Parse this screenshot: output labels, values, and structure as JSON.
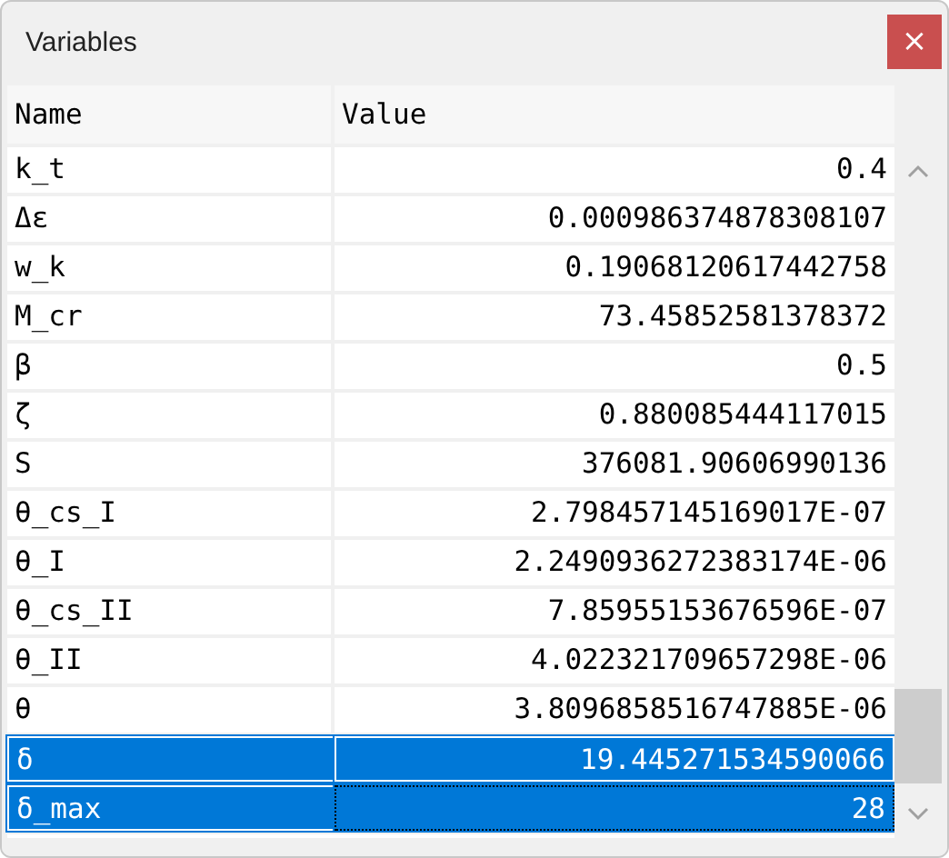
{
  "window": {
    "title": "Variables",
    "close": "×"
  },
  "table": {
    "columns": [
      "Name",
      "Value"
    ],
    "rows": [
      {
        "name": "k_t",
        "value": "0.4",
        "selected": false,
        "focused": false
      },
      {
        "name": "Δε",
        "value": "0.000986374878308107",
        "selected": false,
        "focused": false
      },
      {
        "name": "w_k",
        "value": "0.19068120617442758",
        "selected": false,
        "focused": false
      },
      {
        "name": "M_cr",
        "value": "73.45852581378372",
        "selected": false,
        "focused": false
      },
      {
        "name": "β",
        "value": "0.5",
        "selected": false,
        "focused": false
      },
      {
        "name": "ζ",
        "value": "0.880085444117015",
        "selected": false,
        "focused": false
      },
      {
        "name": "S",
        "value": "376081.90606990136",
        "selected": false,
        "focused": false
      },
      {
        "name": "θ_cs_I",
        "value": "2.798457145169017E-07",
        "selected": false,
        "focused": false
      },
      {
        "name": "θ_I",
        "value": "2.2490936272383174E-06",
        "selected": false,
        "focused": false
      },
      {
        "name": "θ_cs_II",
        "value": "7.85955153676596E-07",
        "selected": false,
        "focused": false
      },
      {
        "name": "θ_II",
        "value": "4.022321709657298E-06",
        "selected": false,
        "focused": false
      },
      {
        "name": "θ",
        "value": "3.8096858516747885E-06",
        "selected": false,
        "focused": false
      },
      {
        "name": "δ",
        "value": "19.445271534590066",
        "selected": true,
        "focused": false
      },
      {
        "name": "δ_max",
        "value": "28",
        "selected": true,
        "focused": true
      }
    ]
  }
}
